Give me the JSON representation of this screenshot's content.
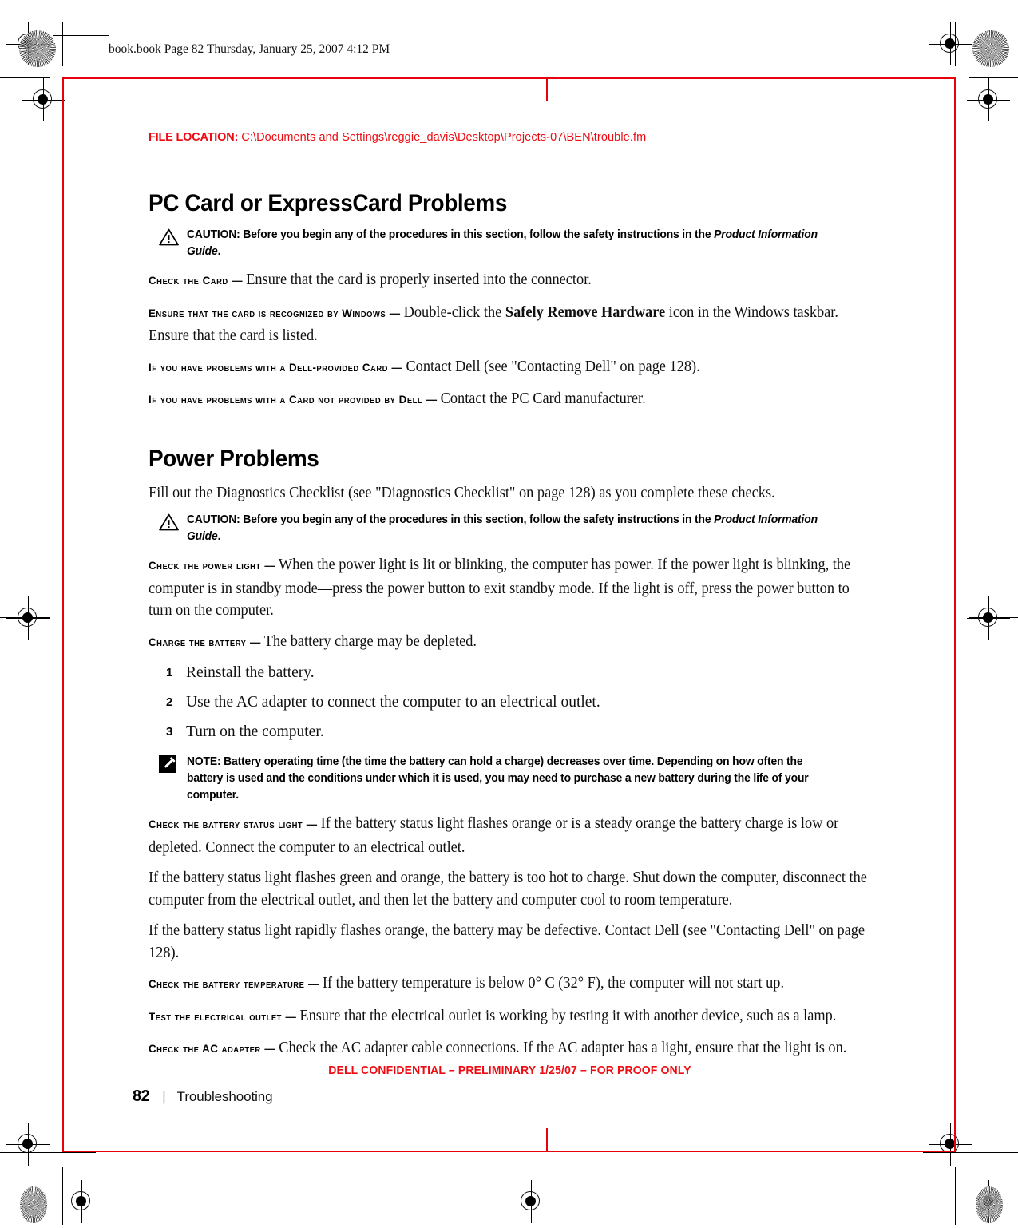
{
  "print_strip": {
    "text": "book.book  Page 82  Thursday, January 25, 2007  4:12 PM"
  },
  "file_location": {
    "label": "FILE LOCATION:",
    "path": "C:\\Documents and Settings\\reggie_davis\\Desktop\\Projects-07\\BEN\\trouble.fm"
  },
  "sections": [
    {
      "heading": "PC Card or ExpressCard Problems",
      "caution": {
        "label": "CAUTION:",
        "text": " Before you begin any of the procedures in this section, follow the safety instructions in the ",
        "italic": "Product Information Guide",
        "tail": "."
      },
      "entries": [
        {
          "lead": "Check the Card",
          "dash": "—",
          "text": " Ensure that the card is properly inserted into the connector."
        },
        {
          "lead": "Ensure that the card is recognized by Windows",
          "dash": "—",
          "text": " Double-click the ",
          "bold": "Safely Remove Hardware",
          "tail": " icon in the Windows taskbar. Ensure that the card is listed."
        },
        {
          "lead": "If you have problems with a Dell-provided Card",
          "dash": "—",
          "text": " Contact Dell (see \"Contacting Dell\" on page 128)."
        },
        {
          "lead": "If you have problems with a Card not provided by Dell",
          "dash": "—",
          "text": " Contact the PC Card manufacturer."
        }
      ]
    }
  ],
  "power": {
    "heading": "Power Problems",
    "intro": "Fill out the Diagnostics Checklist (see \"Diagnostics Checklist\" on page 128) as you complete these checks.",
    "caution": {
      "label": "CAUTION:",
      "text": " Before you begin any of the procedures in this section, follow the safety instructions in the ",
      "italic": "Product Information Guide",
      "tail": "."
    },
    "check_power_light": {
      "lead": "Check the power light",
      "dash": "—",
      "text": " When the power light is lit or blinking, the computer has power. If the power light is blinking, the computer is in standby mode—press the power button to exit standby mode. If the light is off, press the power button to turn on the computer."
    },
    "charge_battery": {
      "lead": "Charge the battery",
      "dash": "—",
      "text": " The battery charge may be depleted."
    },
    "steps": [
      {
        "num": "1",
        "text": "Reinstall the battery."
      },
      {
        "num": "2",
        "text": "Use the AC adapter to connect the computer to an electrical outlet."
      },
      {
        "num": "3",
        "text": "Turn on the computer."
      }
    ],
    "note": {
      "label": "NOTE:",
      "text": " Battery operating time (the time the battery can hold a charge) decreases over time. Depending on how often the battery is used and the conditions under which it is used, you may need to purchase a new battery during the life of your computer."
    },
    "battery_status_light": {
      "lead": "Check the battery status light",
      "dash": "—",
      "text": " If the battery status light flashes orange or is a steady orange the battery charge is low or depleted. Connect the computer to an electrical outlet."
    },
    "para_green_orange": "If the battery status light flashes green and orange, the battery is too hot to charge. Shut down the computer, disconnect the computer from the electrical outlet, and then let the battery and computer cool to room temperature.",
    "para_rapid_orange": "If the battery status light rapidly flashes orange, the battery may be defective. Contact Dell (see \"Contacting Dell\" on page 128).",
    "battery_temperature": {
      "lead": "Check the battery temperature",
      "dash": "—",
      "text": " If the battery temperature is below 0° C (32° F), the computer will not start up."
    },
    "test_outlet": {
      "lead": "Test the electrical outlet",
      "dash": "—",
      "text": " Ensure that the electrical outlet is working by testing it with another device, such as a lamp."
    },
    "check_ac_adapter": {
      "lead": "Check the AC adapter",
      "dash": "—",
      "text": " Check the AC adapter cable connections. If the AC adapter has a light, ensure that the light is on."
    }
  },
  "footer": {
    "confidential": "DELL CONFIDENTIAL – PRELIMINARY 1/25/07 – FOR PROOF ONLY",
    "page_number": "82",
    "separator": "|",
    "section_name": "Troubleshooting"
  },
  "colors": {
    "proof_red": "#ee0a10",
    "text_black": "#111111"
  }
}
